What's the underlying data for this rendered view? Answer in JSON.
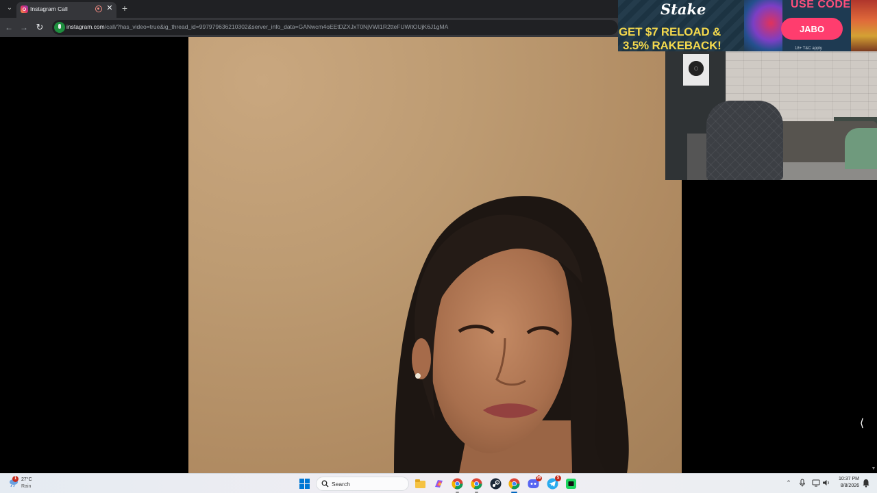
{
  "browser": {
    "tab": {
      "title": "Instagram Call"
    },
    "url": {
      "host": "instagram.com",
      "path": "/call/?has_video=true&ig_thread_id=997979636210302&server_info_data=GANwcm4oEEtDZXJxT0NjVWI1R2tteFUWitOUjK6J1gMA"
    }
  },
  "call": {
    "remote_participant": "remote-video-feed"
  },
  "stream_overlay": {
    "ad": {
      "brand": "Stake",
      "headline_line1": "GET $7 RELOAD &",
      "headline_line2": "3.5% RAKEBACK!",
      "use_code_label": "USE CODE",
      "code": "JABO",
      "terms": "18+ T&C apply"
    }
  },
  "taskbar": {
    "weather": {
      "temp": "27°C",
      "condition": "Rain",
      "badge": "1"
    },
    "search_label": "Search",
    "apps": [
      {
        "name": "file-explorer",
        "badge": ""
      },
      {
        "name": "copilot",
        "badge": ""
      },
      {
        "name": "chrome-1",
        "badge": ""
      },
      {
        "name": "chrome-2",
        "badge": ""
      },
      {
        "name": "steam",
        "badge": ""
      },
      {
        "name": "chrome-3",
        "badge": ""
      },
      {
        "name": "discord",
        "badge": "99"
      },
      {
        "name": "telegram",
        "badge": "5"
      },
      {
        "name": "spotify-like",
        "badge": ""
      }
    ],
    "clock": {
      "time": "10:37 PM",
      "date": "8/8/2026"
    }
  },
  "colors": {
    "chrome_dark": "#202124",
    "chrome_toolbar": "#35363a",
    "ad_yellow": "#f4d94d",
    "ad_pink": "#ff3d6e",
    "windows_blue": "#0078d4"
  }
}
